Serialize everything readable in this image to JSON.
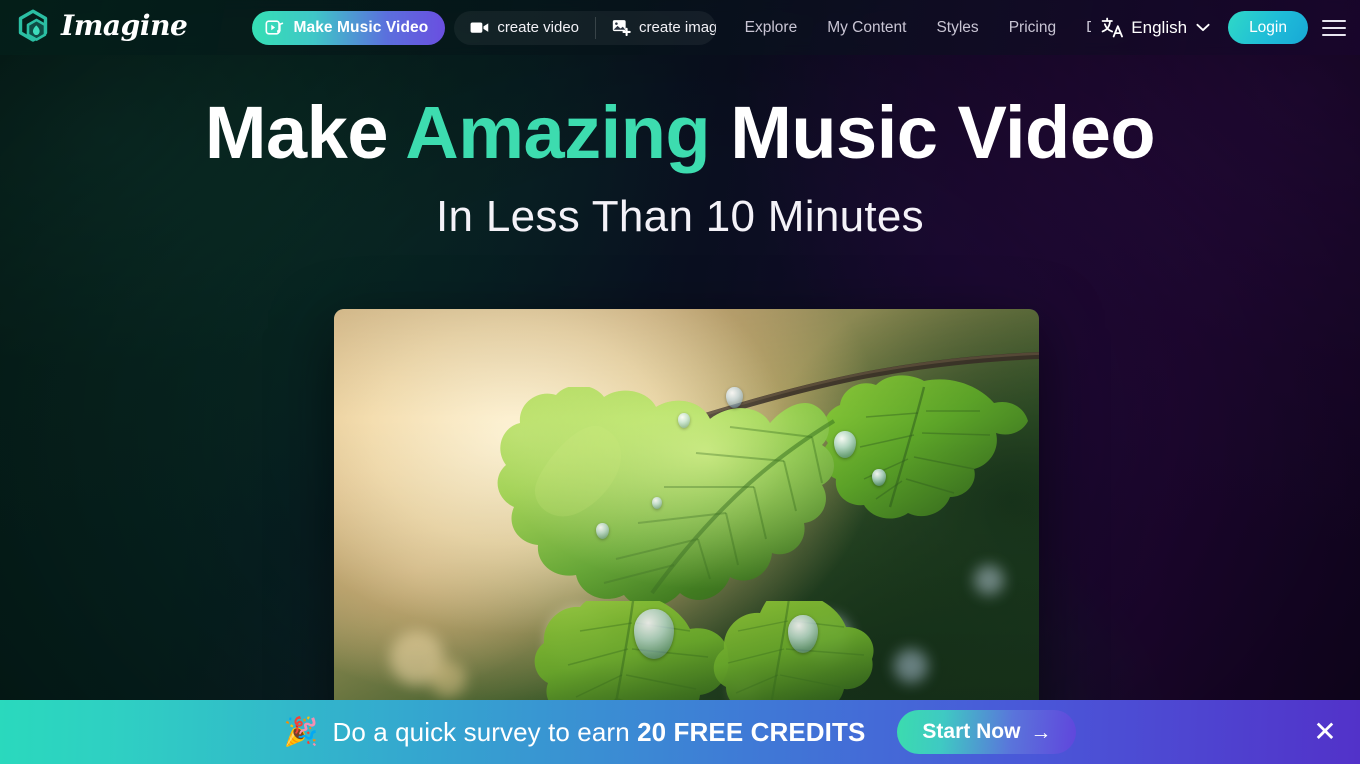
{
  "theme": {
    "accent_mint": "#3ddcaf",
    "accent_teal": "#2ad9bd",
    "accent_purple": "#5232c9",
    "nav_link_color": "#c9c5d4",
    "text_white": "#ffffff",
    "bg_left": "#06251f",
    "bg_right": "#1d0630",
    "banner_gradient_from": "#2ad9bd",
    "banner_gradient_to": "#5232c9"
  },
  "header": {
    "logo": {
      "mark_icon": "hexagon-gem-logo-icon",
      "text": "Imagine"
    },
    "primary_cta": {
      "label": "Make Music Video",
      "icon": "video-music-icon"
    },
    "create_group": [
      {
        "label": "create video",
        "icon": "video-camera-icon"
      },
      {
        "label": "create image",
        "icon": "image-plus-icon"
      }
    ],
    "nav_links": [
      {
        "label": "Explore"
      },
      {
        "label": "My Content"
      },
      {
        "label": "Styles"
      },
      {
        "label": "Pricing"
      },
      {
        "label": "Docur"
      }
    ],
    "language": {
      "icon": "translate-icon",
      "label": "English",
      "chevron_icon": "chevron-down-icon"
    },
    "login_label": "Login",
    "menu_icon": "hamburger-menu-icon"
  },
  "hero": {
    "headline_part1": "Make ",
    "headline_accent": "Amazing",
    "headline_part2": " Music Video",
    "subheadline": "In Less Than 10 Minutes",
    "media_alt": "Backlit green oak leaf with water droplets at golden hour"
  },
  "survey_banner": {
    "emoji": "🎉",
    "text_before": "Do a quick survey to earn ",
    "text_highlight": "20 FREE CREDITS",
    "button_label": "Start Now",
    "button_arrow": "→",
    "close_icon": "close-icon",
    "close_glyph": "✕"
  }
}
